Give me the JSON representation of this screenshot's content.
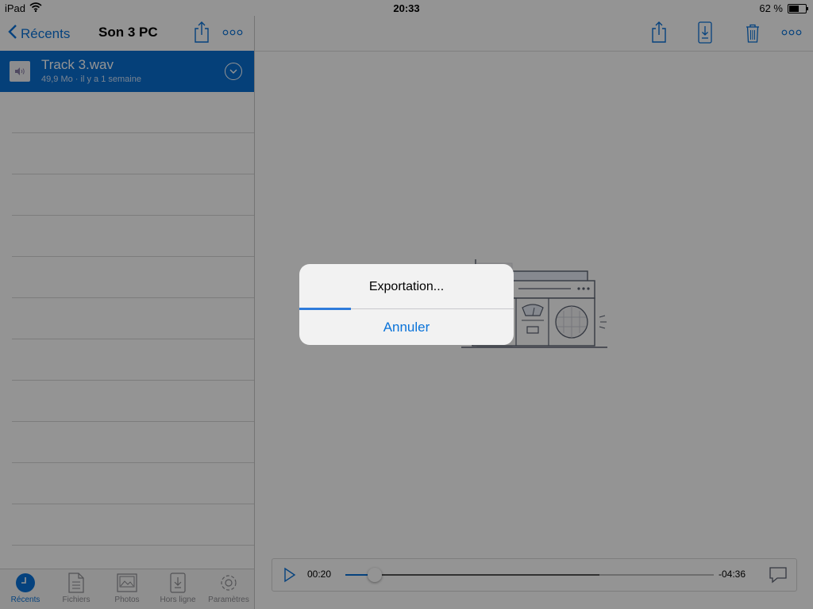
{
  "status": {
    "device": "iPad",
    "time": "20:33",
    "battery_text": "62 %",
    "battery_level": 0.62
  },
  "left_nav": {
    "back_label": "Récents",
    "title": "Son 3 PC"
  },
  "file": {
    "name": "Track 3.wav",
    "meta": "49,9 Mo · il y a 1 semaine"
  },
  "tabs": [
    {
      "label": "Récents",
      "icon": "clock-icon",
      "active": true
    },
    {
      "label": "Fichiers",
      "icon": "document-icon"
    },
    {
      "label": "Photos",
      "icon": "photo-icon"
    },
    {
      "label": "Hors ligne",
      "icon": "offline-device-icon"
    },
    {
      "label": "Paramètres",
      "icon": "gear-icon"
    }
  ],
  "player": {
    "elapsed": "00:20",
    "remaining": "-04:36",
    "progress": 0.08,
    "buffered": 0.69
  },
  "dialog": {
    "title": "Exportation...",
    "cancel_label": "Annuler",
    "progress": 0.24
  },
  "colors": {
    "accent": "#0a73d9",
    "selection": "#0a6ed1"
  }
}
